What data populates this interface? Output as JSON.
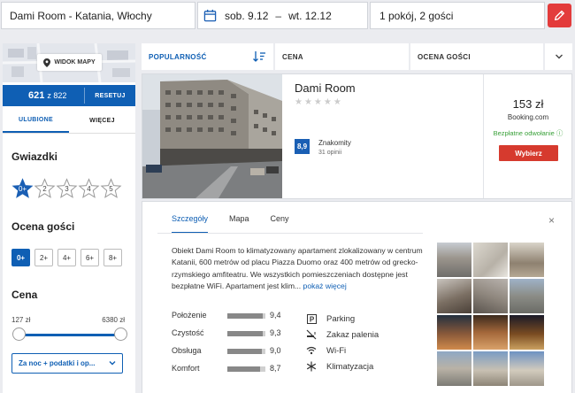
{
  "search": {
    "destination": "Dami Room - Katania, Włochy",
    "check_in": "sob. 9.12",
    "arrow": "–",
    "check_out": "wt. 12.12",
    "guests": "1 pokój, 2 gości"
  },
  "sidebar": {
    "map_button": "WIDOK MAPY",
    "count": "621",
    "count_total": "z 822",
    "reset": "RESETUJ",
    "tabs": [
      "ULUBIONE",
      "WIĘCEJ"
    ],
    "stars_title": "Gwiazdki",
    "stars": [
      "0+",
      "2",
      "3",
      "4",
      "5"
    ],
    "rating_title": "Ocena gości",
    "ratings": [
      "0+",
      "2+",
      "4+",
      "6+",
      "8+"
    ],
    "price_title": "Cena",
    "price_min": "127 zł",
    "price_max": "6380 zł",
    "price_mode": "Za noc + podatki i op..."
  },
  "sort": {
    "popularity": "POPULARNOŚĆ",
    "price": "CENA",
    "rating": "OCENA GOŚCI"
  },
  "hotel": {
    "name": "Dami Room",
    "stars": "★★★★★",
    "score": "8,9",
    "score_label": "Znakomity",
    "reviews": "31 opinii",
    "price": "153 zł",
    "source": "Booking.com",
    "free_cancel": "Bezpłatne odwołanie ⓘ",
    "select_button": "Wybierz"
  },
  "details": {
    "tabs": [
      "Szczegóły",
      "Mapa",
      "Ceny"
    ],
    "close": "×",
    "description": "Obiekt Dami Room to klimatyzowany apartament zlokalizowany w centrum Katanii, 600 metrów od placu Piazza Duomo oraz 400 metrów od grecko-rzymskiego amfiteatru. We wszystkich pomieszczeniach dostępne jest bezpłatne WiFi. Apartament jest klim...",
    "more": " pokaż więcej",
    "ratings": [
      {
        "label": "Położenie",
        "value": "9,4",
        "fraction": 0.94
      },
      {
        "label": "Czystość",
        "value": "9,3",
        "fraction": 0.93
      },
      {
        "label": "Obsługa",
        "value": "9,0",
        "fraction": 0.9
      },
      {
        "label": "Komfort",
        "value": "8,7",
        "fraction": 0.87
      }
    ],
    "amenities": [
      {
        "icon": "parking-icon",
        "label": "Parking"
      },
      {
        "icon": "no-smoking-icon",
        "label": "Zakaz palenia"
      },
      {
        "icon": "wifi-icon",
        "label": "Wi-Fi"
      },
      {
        "icon": "snowflake-icon",
        "label": "Klimatyzacja"
      }
    ]
  },
  "colors": {
    "accent": "#0f5fb4",
    "cta": "#d63a2e",
    "edit": "#e33b3b",
    "free_cancel": "#3aa13a"
  }
}
